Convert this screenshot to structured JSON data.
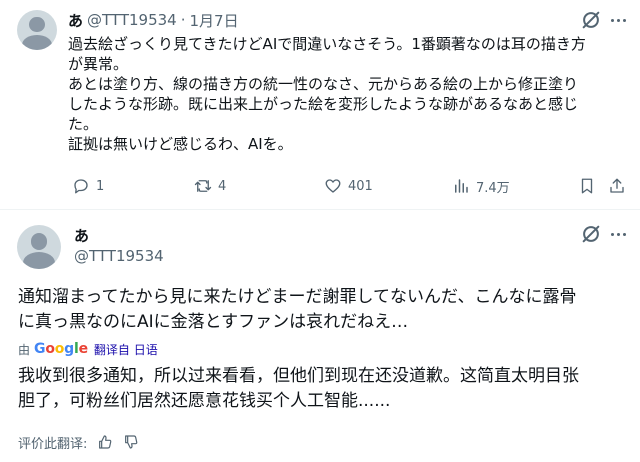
{
  "tweet": {
    "author_name": "あ",
    "author_handle": "@TTT19534",
    "separator": "·",
    "date": "1月7日",
    "lines": [
      "過去絵ざっくり見てきたけどAIで間違いなさそう。1番顕著なのは耳の描き方",
      "が異常。",
      "あとは塗り方、線の描き方の統一性のなさ、元からある絵の上から修正塗り",
      "したような形跡。既に出来上がった絵を変形したような跡があるなあと感じ",
      "た。",
      "証拠は無いけど感じるわ、AIを。"
    ],
    "replies": "1",
    "retweets": "4",
    "likes": "401",
    "views": "7.4万"
  },
  "reply": {
    "author_name": "あ",
    "author_handle": "@TTT19534",
    "original_lines": [
      "通知溜まってたから見に来たけどまーだ謝罪してないんだ、こんなに露骨",
      "に真っ黒なのにAIに金落とすファンは哀れだねえ…"
    ],
    "translated_by_prefix": "由",
    "translated_by_suffix": "翻译自 日语",
    "translation_lines": [
      "我收到很多通知，所以过来看看，但他们到现在还没道歉。这简直太明目张",
      "胆了，可粉丝们居然还愿意花钱买个人工智能......"
    ],
    "rate_label": "评价此翻译:"
  },
  "icons": {
    "grok": "grok-icon",
    "more": "more-icon",
    "reply": "reply-icon",
    "retweet": "retweet-icon",
    "like": "heart-icon",
    "views": "views-icon",
    "bookmark": "bookmark-icon",
    "share": "share-icon",
    "thumbs_up": "thumbs-up-icon",
    "thumbs_down": "thumbs-down-icon"
  },
  "colors": {
    "text": "#0f1419",
    "secondary": "#536471",
    "link": "#1a0dab"
  }
}
